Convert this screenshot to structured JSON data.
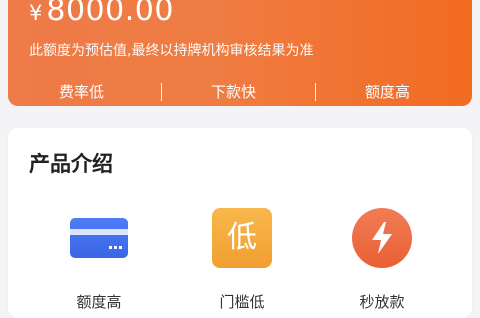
{
  "banner": {
    "currency": "¥",
    "amount": "8000.00",
    "disclaimer": "此额度为预估值,最终以持牌机构审核结果为准",
    "features": [
      "费率低",
      "下款快",
      "额度高"
    ]
  },
  "products_section": {
    "title": "产品介绍",
    "items": [
      {
        "icon": "credit-card-icon",
        "label": "额度高"
      },
      {
        "icon": "low-rate-icon",
        "icon_text": "低",
        "label": "门槛低"
      },
      {
        "icon": "lightning-bolt-icon",
        "label": "秒放款"
      }
    ]
  },
  "colors": {
    "banner_gradient_start": "#ee7b48",
    "banner_gradient_end": "#f26b22",
    "card_icon_blue": "#3c6df0",
    "low_icon_orange": "#f29e30",
    "bolt_icon_red": "#ea5f34",
    "background": "#f4f4f6"
  }
}
